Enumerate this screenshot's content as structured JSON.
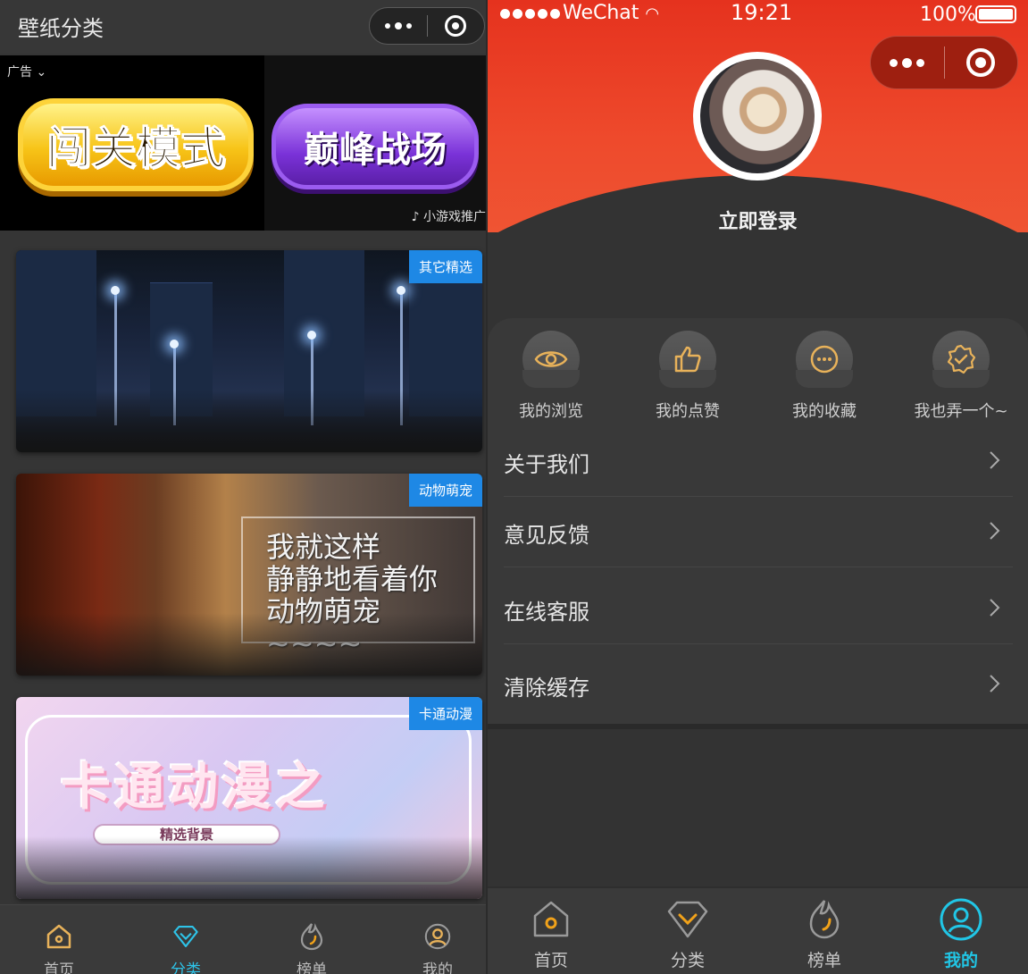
{
  "left": {
    "header": {
      "title": "壁纸分类"
    },
    "ad": {
      "label": "广告",
      "button1": "闯关模式",
      "button2": "巅峰战场",
      "promo": "小游戏推广"
    },
    "categories": [
      {
        "tag": "其它精选"
      },
      {
        "tag": "动物萌宠",
        "overlay_lines": [
          "我就这样",
          "静静地看着你",
          "动物萌宠~~~~"
        ]
      },
      {
        "tag": "卡通动漫",
        "title": "卡通动漫之",
        "pill": "精选背景"
      }
    ],
    "tabbar": [
      {
        "label": "首页",
        "icon": "home-icon"
      },
      {
        "label": "分类",
        "icon": "diamond-icon",
        "active": true
      },
      {
        "label": "榜单",
        "icon": "flame-icon"
      },
      {
        "label": "我的",
        "icon": "user-icon"
      }
    ]
  },
  "right": {
    "status": {
      "carrier": "WeChat",
      "time": "19:21",
      "battery": "100%"
    },
    "login": "立即登录",
    "quick_actions": [
      {
        "label": "我的浏览",
        "icon": "eye-icon"
      },
      {
        "label": "我的点赞",
        "icon": "thumbs-up-icon"
      },
      {
        "label": "我的收藏",
        "icon": "ellipsis-icon"
      },
      {
        "label": "我也弄一个~",
        "icon": "badge-check-icon"
      }
    ],
    "menu": [
      "关于我们",
      "意见反馈",
      "在线客服",
      "清除缓存"
    ],
    "tabbar": [
      {
        "label": "首页",
        "icon": "home-icon"
      },
      {
        "label": "分类",
        "icon": "diamond-icon"
      },
      {
        "label": "榜单",
        "icon": "flame-icon"
      },
      {
        "label": "我的",
        "icon": "user-icon",
        "active": true
      }
    ]
  },
  "colors": {
    "accent": "#2ec3e8",
    "tag_blue": "#1e88e5",
    "icon_gold": "#e8b25a",
    "hero_red": "#e5321e"
  }
}
